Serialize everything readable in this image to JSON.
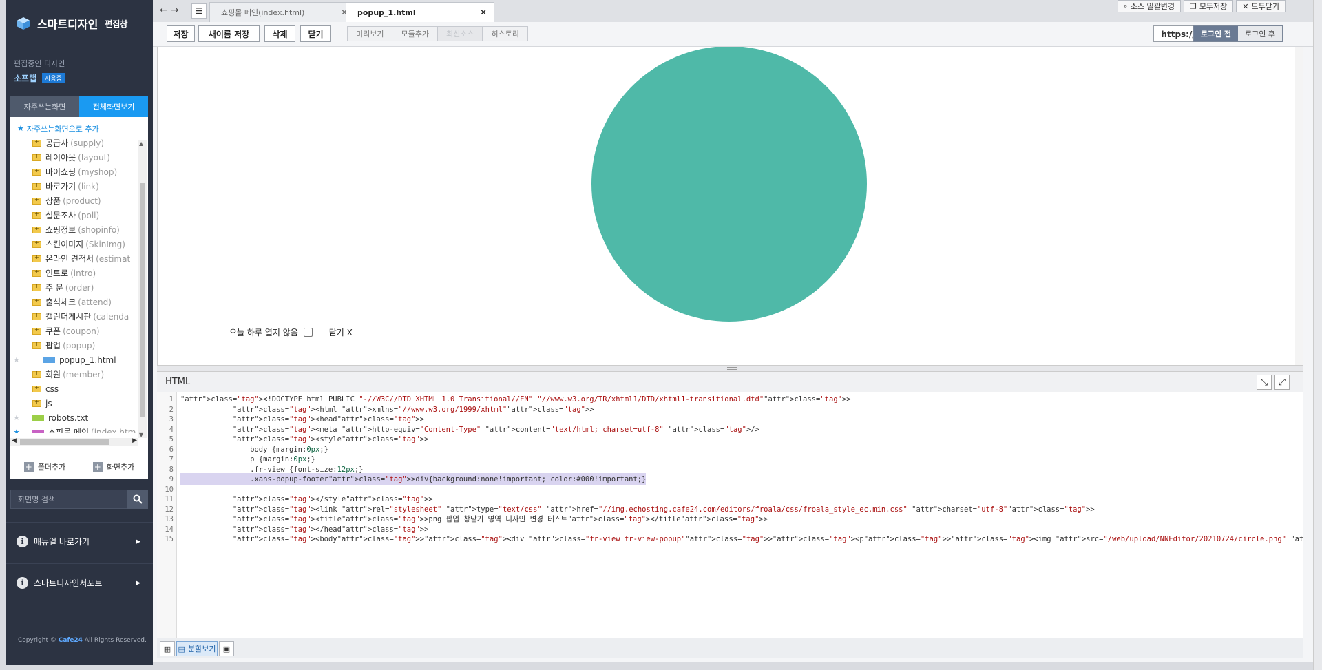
{
  "sidebar": {
    "brand_title": "스마트디자인",
    "brand_sub": "편집창",
    "editing_label": "편집중인 디자인",
    "design_name": "소프랩",
    "design_badge": "사용중",
    "tab_frequent": "자주쓰는화면",
    "tab_all": "전체화면보기",
    "add_favorite": "자주쓰는화면으로 추가",
    "tree": [
      {
        "label": "공급사",
        "en": "(supply)",
        "type": "folder",
        "fav": false
      },
      {
        "label": "레이아웃",
        "en": "(layout)",
        "type": "folder",
        "fav": false
      },
      {
        "label": "마이쇼핑",
        "en": "(myshop)",
        "type": "folder",
        "fav": false
      },
      {
        "label": "바로가기",
        "en": "(link)",
        "type": "folder",
        "fav": false
      },
      {
        "label": "상품",
        "en": "(product)",
        "type": "folder",
        "fav": false
      },
      {
        "label": "설문조사",
        "en": "(poll)",
        "type": "folder",
        "fav": false
      },
      {
        "label": "쇼핑정보",
        "en": "(shopinfo)",
        "type": "folder",
        "fav": false
      },
      {
        "label": "스킨이미지",
        "en": "(SkinImg)",
        "type": "folder",
        "fav": false
      },
      {
        "label": "온라인 견적서",
        "en": "(estimat",
        "type": "folder",
        "fav": false
      },
      {
        "label": "인트로",
        "en": "(intro)",
        "type": "folder",
        "fav": false
      },
      {
        "label": "주 문",
        "en": "(order)",
        "type": "folder",
        "fav": false
      },
      {
        "label": "출석체크",
        "en": "(attend)",
        "type": "folder",
        "fav": false
      },
      {
        "label": "캘린더게시판",
        "en": "(calenda",
        "type": "folder",
        "fav": false
      },
      {
        "label": "쿠폰",
        "en": "(coupon)",
        "type": "folder",
        "fav": false
      },
      {
        "label": "팝업",
        "en": "(popup)",
        "type": "folder-open",
        "fav": false
      },
      {
        "label": "popup_1.html",
        "en": "",
        "type": "html",
        "fav": true
      },
      {
        "label": "회원",
        "en": "(member)",
        "type": "folder",
        "fav": false
      },
      {
        "label": "css",
        "en": "",
        "type": "folder",
        "fav": false
      },
      {
        "label": "js",
        "en": "",
        "type": "folder",
        "fav": false
      },
      {
        "label": "robots.txt",
        "en": "",
        "type": "txt",
        "fav": true
      },
      {
        "label": "쇼핑몰 메인",
        "en": "(index.htm",
        "type": "pink",
        "fav": true,
        "fav_active": true
      }
    ],
    "add_folder": "폴더추가",
    "add_screen": "화면추가",
    "search_placeholder": "화면명 검색",
    "manual_link": "매뉴얼 바로가기",
    "support_link": "스마트디자인서포트",
    "copyright_prefix": "Copyright ©",
    "copyright_brand": "Cafe24",
    "copyright_suffix": "All Rights Reserved."
  },
  "tabs": {
    "tab1": "쇼핑몰 메인(index.html)",
    "tab2": "popup_1.html"
  },
  "right_tools": {
    "source_change": "소스 일괄변경",
    "save_all": "모두저장",
    "close_all": "모두닫기"
  },
  "toolbar": {
    "save": "저장",
    "save_as": "새이름 저장",
    "delete": "삭제",
    "close": "닫기",
    "preview": "미리보기",
    "add_module": "모듈추가",
    "latest_source": "최신소스",
    "history": "히스토리",
    "https": "https:// 변경",
    "login_before": "로그인 전",
    "login_after": "로그인 후"
  },
  "preview": {
    "no_show_today": "오늘 하루 열지 않음",
    "close": "닫기 X",
    "circle_color": "#4fb9a8"
  },
  "editor": {
    "mode_label": "HTML",
    "split_view": "분할보기",
    "lines": [
      "<!DOCTYPE html PUBLIC \"-//W3C//DTD XHTML 1.0 Transitional//EN\" \"//www.w3.org/TR/xhtml1/DTD/xhtml1-transitional.dtd\">",
      "            <html xmlns=\"//www.w3.org/1999/xhtml\">",
      "            <head>",
      "            <meta http-equiv=\"Content-Type\" content=\"text/html; charset=utf-8\" />",
      "            <style>",
      "                body {margin:0px;}",
      "                p {margin:0px;}",
      "                .fr-view {font-size:12px;}",
      "                .xans-popup-footer>div{background:none!important; color:#000!important;}",
      "",
      "            </style>",
      "            <link rel=\"stylesheet\" type=\"text/css\" href=\"//img.echosting.cafe24.com/editors/froala/css/froala_style_ec.min.css\" charset=\"utf-8\">",
      "            <title>png 팝업 창닫기 영역 디자인 변경 테스트</title>",
      "            </head>",
      "            <body><div class=\"fr-view fr-view-popup\"><p><img src=\"/web/upload/NNEditor/20210724/circle.png\" class=\"fr-fic fr-dib\" name=\"circle.png\" size=\"400px/400px\"></p></div><div module=\"Popup_Footer\">{$footer}</div></body></html>"
    ]
  }
}
